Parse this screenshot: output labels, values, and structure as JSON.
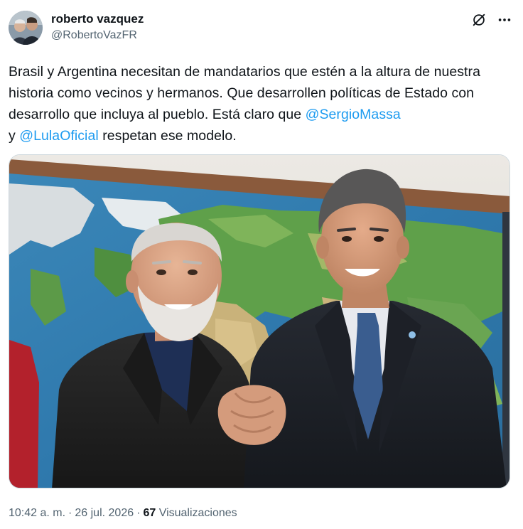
{
  "author": {
    "display_name": "roberto vazquez",
    "handle": "@RobertoVazFR",
    "avatar_icon": "avatar-photo"
  },
  "header_icons": [
    "grok-icon",
    "more-icon"
  ],
  "tweet": {
    "text_1": "Brasil y Argentina necesitan de mandatarios que estén a la altura de nuestra historia como vecinos y hermanos. Que desarrollen políticas de Estado con desarrollo que incluya al pueblo. Está claro que ",
    "mention_1": "@SergioMassa",
    "text_2": "y ",
    "mention_2": "@LulaOficial",
    "text_3": " respetan ese modelo."
  },
  "media": {
    "kind": "photo"
  },
  "meta": {
    "time": "10:42 a. m.",
    "separator": "·",
    "date": "26 jul. 2026",
    "views_count": "67",
    "views_label": "Visualizaciones"
  },
  "colors": {
    "text": "#0f1419",
    "secondary": "#536471",
    "link": "#1d9bf0",
    "border": "#cfd9de"
  }
}
